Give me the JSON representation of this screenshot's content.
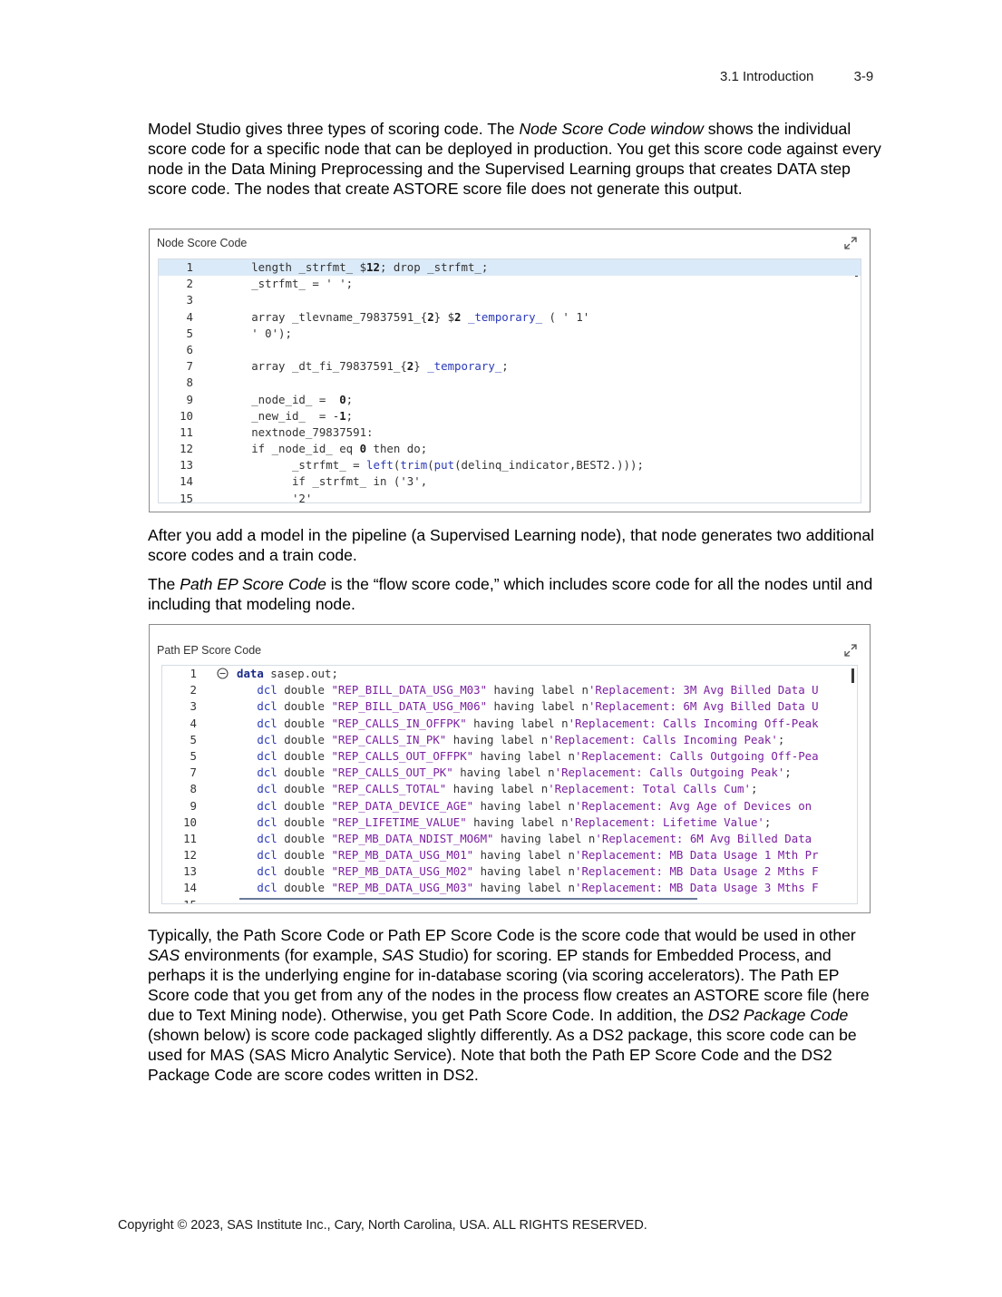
{
  "header": {
    "section": "3.1  Introduction",
    "page": "3-9"
  },
  "para1": {
    "t1": "Model Studio gives three types of scoring code. The ",
    "i1": "Node Score Code window",
    "t2": " shows the individual score code for a specific node that can be deployed in production. You get this score code against every node in the Data Mining Preprocessing and the Supervised Learning groups that creates DATA step score code. The nodes that create ASTORE score file does not generate this output."
  },
  "panel1": {
    "title": "Node Score Code",
    "lines": [
      {
        "n": "1",
        "tokens": [
          [
            "",
            "       length _strfmt_ $"
          ],
          [
            "num",
            "12"
          ],
          [
            "",
            "; drop _strfmt_;"
          ]
        ]
      },
      {
        "n": "2",
        "tokens": [
          [
            "",
            "       _strfmt_ = ' ';"
          ]
        ]
      },
      {
        "n": "3",
        "tokens": []
      },
      {
        "n": "4",
        "tokens": [
          [
            "",
            "       array _tlevname_79837591_{"
          ],
          [
            "num",
            "2"
          ],
          [
            "",
            "} $"
          ],
          [
            "num",
            "2"
          ],
          [
            "fn",
            " _temporary_"
          ],
          [
            "",
            " ( ' 1'"
          ]
        ]
      },
      {
        "n": "5",
        "tokens": [
          [
            "",
            "       ' 0');"
          ]
        ]
      },
      {
        "n": "6",
        "tokens": []
      },
      {
        "n": "7",
        "tokens": [
          [
            "",
            "       array _dt_fi_79837591_{"
          ],
          [
            "num",
            "2"
          ],
          [
            "",
            "} "
          ],
          [
            "fn",
            "_temporary_"
          ],
          [
            "",
            ";"
          ]
        ]
      },
      {
        "n": "8",
        "tokens": []
      },
      {
        "n": "9",
        "tokens": [
          [
            "",
            "       _node_id_ =  "
          ],
          [
            "num",
            "0"
          ],
          [
            "",
            ";"
          ]
        ]
      },
      {
        "n": "10",
        "tokens": [
          [
            "",
            "       _new_id_  = -"
          ],
          [
            "num",
            "1"
          ],
          [
            "",
            ";"
          ]
        ]
      },
      {
        "n": "11",
        "tokens": [
          [
            "",
            "       nextnode_79837591:"
          ]
        ]
      },
      {
        "n": "12",
        "tokens": [
          [
            "",
            "       if _node_id_ eq "
          ],
          [
            "num",
            "0"
          ],
          [
            "",
            " then do;"
          ]
        ]
      },
      {
        "n": "13",
        "tokens": [
          [
            "",
            "             _strfmt_ = "
          ],
          [
            "fn",
            "left"
          ],
          [
            "",
            "("
          ],
          [
            "fn",
            "trim"
          ],
          [
            "",
            "("
          ],
          [
            "fn",
            "put"
          ],
          [
            "",
            "(delinq_indicator,BEST2.)));"
          ]
        ]
      },
      {
        "n": "14",
        "tokens": [
          [
            "",
            "             if _strfmt_ in ('3',"
          ]
        ]
      },
      {
        "n": "15",
        "tokens": [
          [
            "",
            "             '2'"
          ]
        ]
      }
    ]
  },
  "para2": "After you add a model in the pipeline (a Supervised Learning node), that node generates two additional score codes and a train code.",
  "para3": {
    "t1": "The ",
    "i1": "Path EP Score Code",
    "t2": " is the “flow score code,” which includes score code for all the nodes until and including that modeling node."
  },
  "panel2": {
    "title": "Path EP Score Code",
    "lines": [
      {
        "n": "1",
        "tokens": [
          [
            "kw",
            "data"
          ],
          [
            "",
            " sasep.out;"
          ]
        ]
      },
      {
        "n": "2",
        "tokens": [
          [
            "fn",
            "   dcl"
          ],
          [
            "",
            " double "
          ],
          [
            "str",
            "\"REP_BILL_DATA_USG_M03\""
          ],
          [
            "",
            " having label n"
          ],
          [
            "str",
            "'Replacement: 3M Avg Billed Data U"
          ]
        ]
      },
      {
        "n": "3",
        "tokens": [
          [
            "fn",
            "   dcl"
          ],
          [
            "",
            " double "
          ],
          [
            "str",
            "\"REP_BILL_DATA_USG_M06\""
          ],
          [
            "",
            " having label n"
          ],
          [
            "str",
            "'Replacement: 6M Avg Billed Data U"
          ]
        ]
      },
      {
        "n": "4",
        "tokens": [
          [
            "fn",
            "   dcl"
          ],
          [
            "",
            " double "
          ],
          [
            "str",
            "\"REP_CALLS_IN_OFFPK\""
          ],
          [
            "",
            " having label n"
          ],
          [
            "str",
            "'Replacement: Calls Incoming Off-Peak"
          ]
        ]
      },
      {
        "n": "5",
        "tokens": [
          [
            "fn",
            "   dcl"
          ],
          [
            "",
            " double "
          ],
          [
            "str",
            "\"REP_CALLS_IN_PK\""
          ],
          [
            "",
            " having label n"
          ],
          [
            "str",
            "'Replacement: Calls Incoming Peak'"
          ],
          [
            "",
            ";"
          ]
        ]
      },
      {
        "n": "5",
        "tokens": [
          [
            "fn",
            "   dcl"
          ],
          [
            "",
            " double "
          ],
          [
            "str",
            "\"REP_CALLS_OUT_OFFPK\""
          ],
          [
            "",
            " having label n"
          ],
          [
            "str",
            "'Replacement: Calls Outgoing Off-Pea"
          ]
        ]
      },
      {
        "n": "7",
        "tokens": [
          [
            "fn",
            "   dcl"
          ],
          [
            "",
            " double "
          ],
          [
            "str",
            "\"REP_CALLS_OUT_PK\""
          ],
          [
            "",
            " having label n"
          ],
          [
            "str",
            "'Replacement: Calls Outgoing Peak'"
          ],
          [
            "",
            ";"
          ]
        ]
      },
      {
        "n": "8",
        "tokens": [
          [
            "fn",
            "   dcl"
          ],
          [
            "",
            " double "
          ],
          [
            "str",
            "\"REP_CALLS_TOTAL\""
          ],
          [
            "",
            " having label n"
          ],
          [
            "str",
            "'Replacement: Total Calls Cum'"
          ],
          [
            "",
            ";"
          ]
        ]
      },
      {
        "n": "9",
        "tokens": [
          [
            "fn",
            "   dcl"
          ],
          [
            "",
            " double "
          ],
          [
            "str",
            "\"REP_DATA_DEVICE_AGE\""
          ],
          [
            "",
            " having label n"
          ],
          [
            "str",
            "'Replacement: Avg Age of Devices on"
          ]
        ]
      },
      {
        "n": "10",
        "tokens": [
          [
            "fn",
            "   dcl"
          ],
          [
            "",
            " double "
          ],
          [
            "str",
            "\"REP_LIFETIME_VALUE\""
          ],
          [
            "",
            " having label n"
          ],
          [
            "str",
            "'Replacement: Lifetime Value'"
          ],
          [
            "",
            ";"
          ]
        ]
      },
      {
        "n": "11",
        "tokens": [
          [
            "fn",
            "   dcl"
          ],
          [
            "",
            " double "
          ],
          [
            "str",
            "\"REP_MB_DATA_NDIST_MO6M\""
          ],
          [
            "",
            " having label n"
          ],
          [
            "str",
            "'Replacement: 6M Avg Billed Data"
          ]
        ]
      },
      {
        "n": "12",
        "tokens": [
          [
            "fn",
            "   dcl"
          ],
          [
            "",
            " double "
          ],
          [
            "str",
            "\"REP_MB_DATA_USG_M01\""
          ],
          [
            "",
            " having label n"
          ],
          [
            "str",
            "'Replacement: MB Data Usage 1 Mth Pr"
          ]
        ]
      },
      {
        "n": "13",
        "tokens": [
          [
            "fn",
            "   dcl"
          ],
          [
            "",
            " double "
          ],
          [
            "str",
            "\"REP_MB_DATA_USG_M02\""
          ],
          [
            "",
            " having label n"
          ],
          [
            "str",
            "'Replacement: MB Data Usage 2 Mths F"
          ]
        ]
      },
      {
        "n": "14",
        "tokens": [
          [
            "fn",
            "   dcl"
          ],
          [
            "",
            " double "
          ],
          [
            "str",
            "\"REP_MB_DATA_USG_M03\""
          ],
          [
            "",
            " having label n"
          ],
          [
            "str",
            "'Replacement: MB Data Usage 3 Mths F"
          ]
        ]
      },
      {
        "n": "15",
        "tokens": []
      }
    ]
  },
  "para4": {
    "t1": "Typically, the Path Score Code or Path EP Score Code is the score code that would be used in other ",
    "i1": "SAS",
    "t2": " environments (for example, ",
    "i2": "SAS",
    "t3": " Studio) for scoring. EP stands for Embedded Process, and perhaps it is the underlying engine for in-database scoring (via scoring accelerators). The Path EP Score code that you get from any of the nodes in the process flow creates an ASTORE score file (here due to Text Mining node). Otherwise, you get Path Score Code. In addition, the ",
    "i3": "DS2 Package Code",
    "t4": " (shown below) is score code packaged slightly differently. As a DS2 package, this score code can be used for MAS (SAS Micro Analytic Service). Note that both the Path EP Score Code and the DS2 Package Code are score codes written in DS2."
  },
  "footer": "Copyright © 2023, SAS Institute Inc., Cary, North Carolina, USA. ALL RIGHTS RESERVED."
}
